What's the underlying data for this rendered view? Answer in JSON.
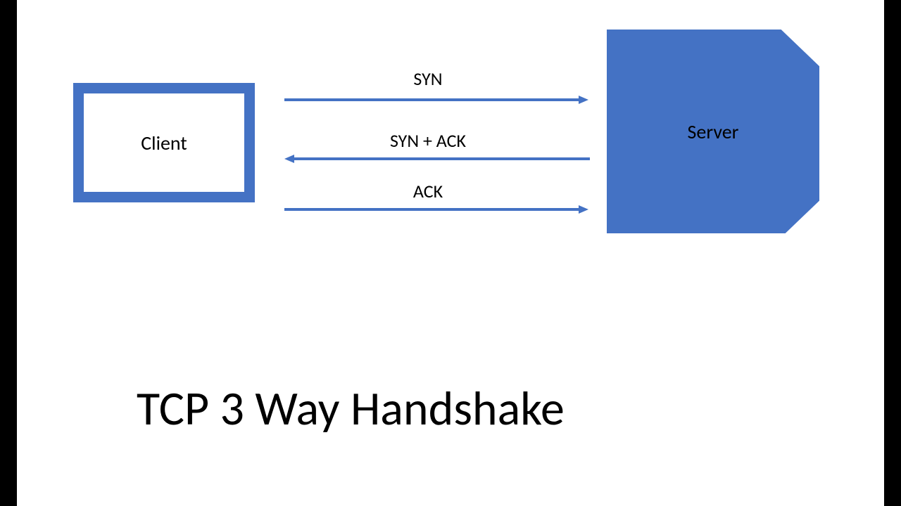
{
  "nodes": {
    "client": "Client",
    "server": "Server"
  },
  "arrows": [
    {
      "label": "SYN",
      "direction": "right"
    },
    {
      "label": "SYN + ACK",
      "direction": "left"
    },
    {
      "label": "ACK",
      "direction": "right"
    }
  ],
  "title": "TCP 3 Way Handshake",
  "colors": {
    "accent": "#4472c4"
  }
}
